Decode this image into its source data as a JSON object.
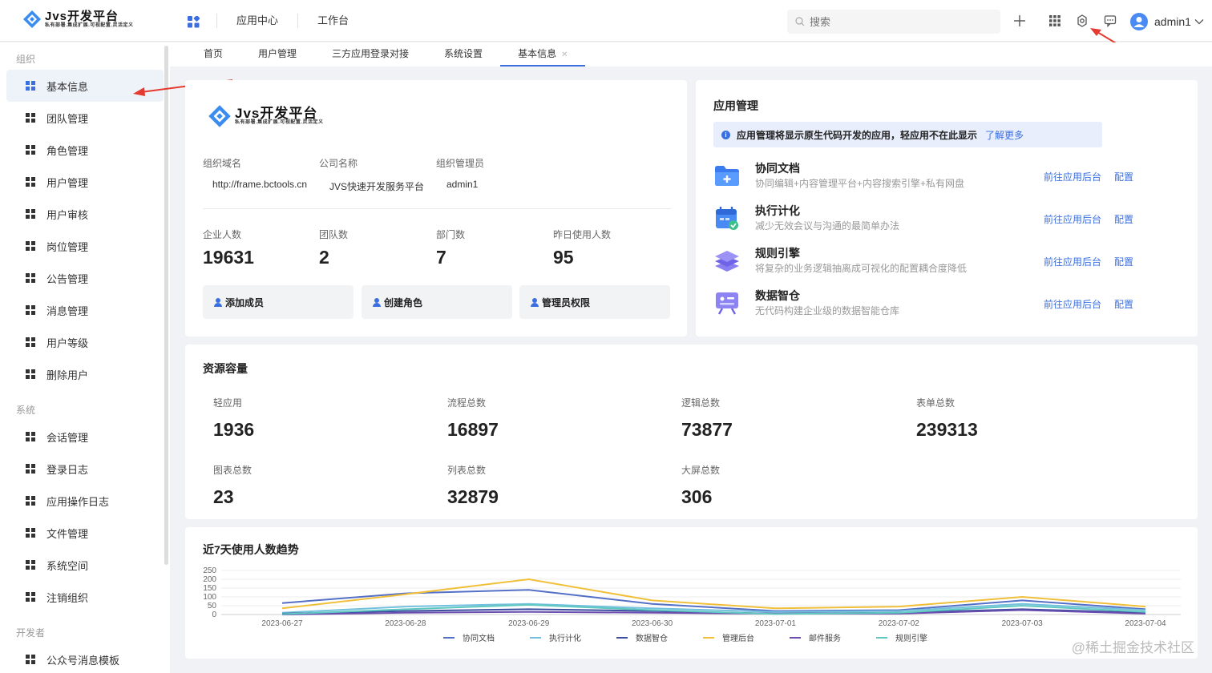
{
  "header": {
    "logo_title": "Jvs开发平台",
    "logo_subtitle": "私有部署.集成扩展.可视配置.灵活定义",
    "nav": [
      "应用中心",
      "工作台"
    ],
    "search_placeholder": "搜索",
    "user_name": "admin1"
  },
  "sidebar": {
    "groups": [
      {
        "title": "组织",
        "items": [
          "基本信息",
          "团队管理",
          "角色管理",
          "用户管理",
          "用户审核",
          "岗位管理",
          "公告管理",
          "消息管理",
          "用户等级",
          "删除用户"
        ]
      },
      {
        "title": "系统",
        "items": [
          "会话管理",
          "登录日志",
          "应用操作日志",
          "文件管理",
          "系统空间",
          "注销组织"
        ]
      },
      {
        "title": "开发者",
        "items": [
          "公众号消息模板"
        ]
      }
    ],
    "active": "基本信息"
  },
  "tabs": [
    "首页",
    "用户管理",
    "三方应用登录对接",
    "系统设置",
    "基本信息"
  ],
  "org": {
    "logo_title": "Jvs开发平台",
    "logo_subtitle": "私有部署.集成扩展.可视配置.灵活定义",
    "fields": [
      {
        "label": "组织域名",
        "value": "http://frame.bctools.cn"
      },
      {
        "label": "公司名称",
        "value": "JVS快速开发服务平台"
      },
      {
        "label": "组织管理员",
        "value": "admin1"
      }
    ],
    "stats": [
      {
        "label": "企业人数",
        "value": "19631"
      },
      {
        "label": "团队数",
        "value": "2"
      },
      {
        "label": "部门数",
        "value": "7"
      },
      {
        "label": "昨日使用人数",
        "value": "95"
      }
    ],
    "actions": [
      "添加成员",
      "创建角色",
      "管理员权限"
    ]
  },
  "apps": {
    "title": "应用管理",
    "notice": "应用管理将显示原生代码开发的应用，轻应用不在此显示",
    "notice_link": "了解更多",
    "link_backend": "前往应用后台",
    "link_config": "配置",
    "items": [
      {
        "name": "协同文档",
        "desc": "协同编辑+内容管理平台+内容搜索引擎+私有网盘",
        "icon": "folder-plus-icon"
      },
      {
        "name": "执行计化",
        "desc": "减少无效会议与沟通的最简单办法",
        "icon": "calendar-check-icon"
      },
      {
        "name": "规则引擎",
        "desc": "将复杂的业务逻辑抽离成可视化的配置耦合度降低",
        "icon": "layers-icon"
      },
      {
        "name": "数据智仓",
        "desc": "无代码构建企业级的数据智能仓库",
        "icon": "data-board-icon"
      }
    ]
  },
  "resources": {
    "title": "资源容量",
    "items": [
      {
        "label": "轻应用",
        "value": "1936"
      },
      {
        "label": "流程总数",
        "value": "16897"
      },
      {
        "label": "逻辑总数",
        "value": "73877"
      },
      {
        "label": "表单总数",
        "value": "239313"
      },
      {
        "label": "图表总数",
        "value": "23"
      },
      {
        "label": "列表总数",
        "value": "32879"
      },
      {
        "label": "大屏总数",
        "value": "306"
      }
    ]
  },
  "trend": {
    "title": "近7天使用人数趋势"
  },
  "chart_data": {
    "type": "line",
    "x": [
      "2023-06-27",
      "2023-06-28",
      "2023-06-29",
      "2023-06-30",
      "2023-07-01",
      "2023-07-02",
      "2023-07-03",
      "2023-07-04"
    ],
    "ylim": [
      0,
      250
    ],
    "yticks": [
      0,
      50,
      100,
      150,
      200,
      250
    ],
    "series": [
      {
        "name": "协同文档",
        "color": "#5470c6",
        "values": [
          65,
          120,
          140,
          60,
          20,
          25,
          80,
          30
        ]
      },
      {
        "name": "执行计化",
        "color": "#73c0de",
        "values": [
          10,
          45,
          60,
          35,
          15,
          20,
          60,
          25
        ]
      },
      {
        "name": "数据智仓",
        "color": "#3d4ea0",
        "values": [
          5,
          20,
          30,
          20,
          5,
          10,
          30,
          10
        ]
      },
      {
        "name": "管理后台",
        "color": "#f0c03a",
        "values": [
          35,
          115,
          200,
          80,
          35,
          45,
          100,
          45
        ]
      },
      {
        "name": "邮件服务",
        "color": "#6a4fb0",
        "values": [
          0,
          10,
          15,
          10,
          5,
          5,
          25,
          5
        ]
      },
      {
        "name": "规则引擎",
        "color": "#5fc9c1",
        "values": [
          2,
          30,
          55,
          25,
          3,
          10,
          50,
          15
        ]
      }
    ]
  },
  "watermark": "@稀土掘金技术社区"
}
